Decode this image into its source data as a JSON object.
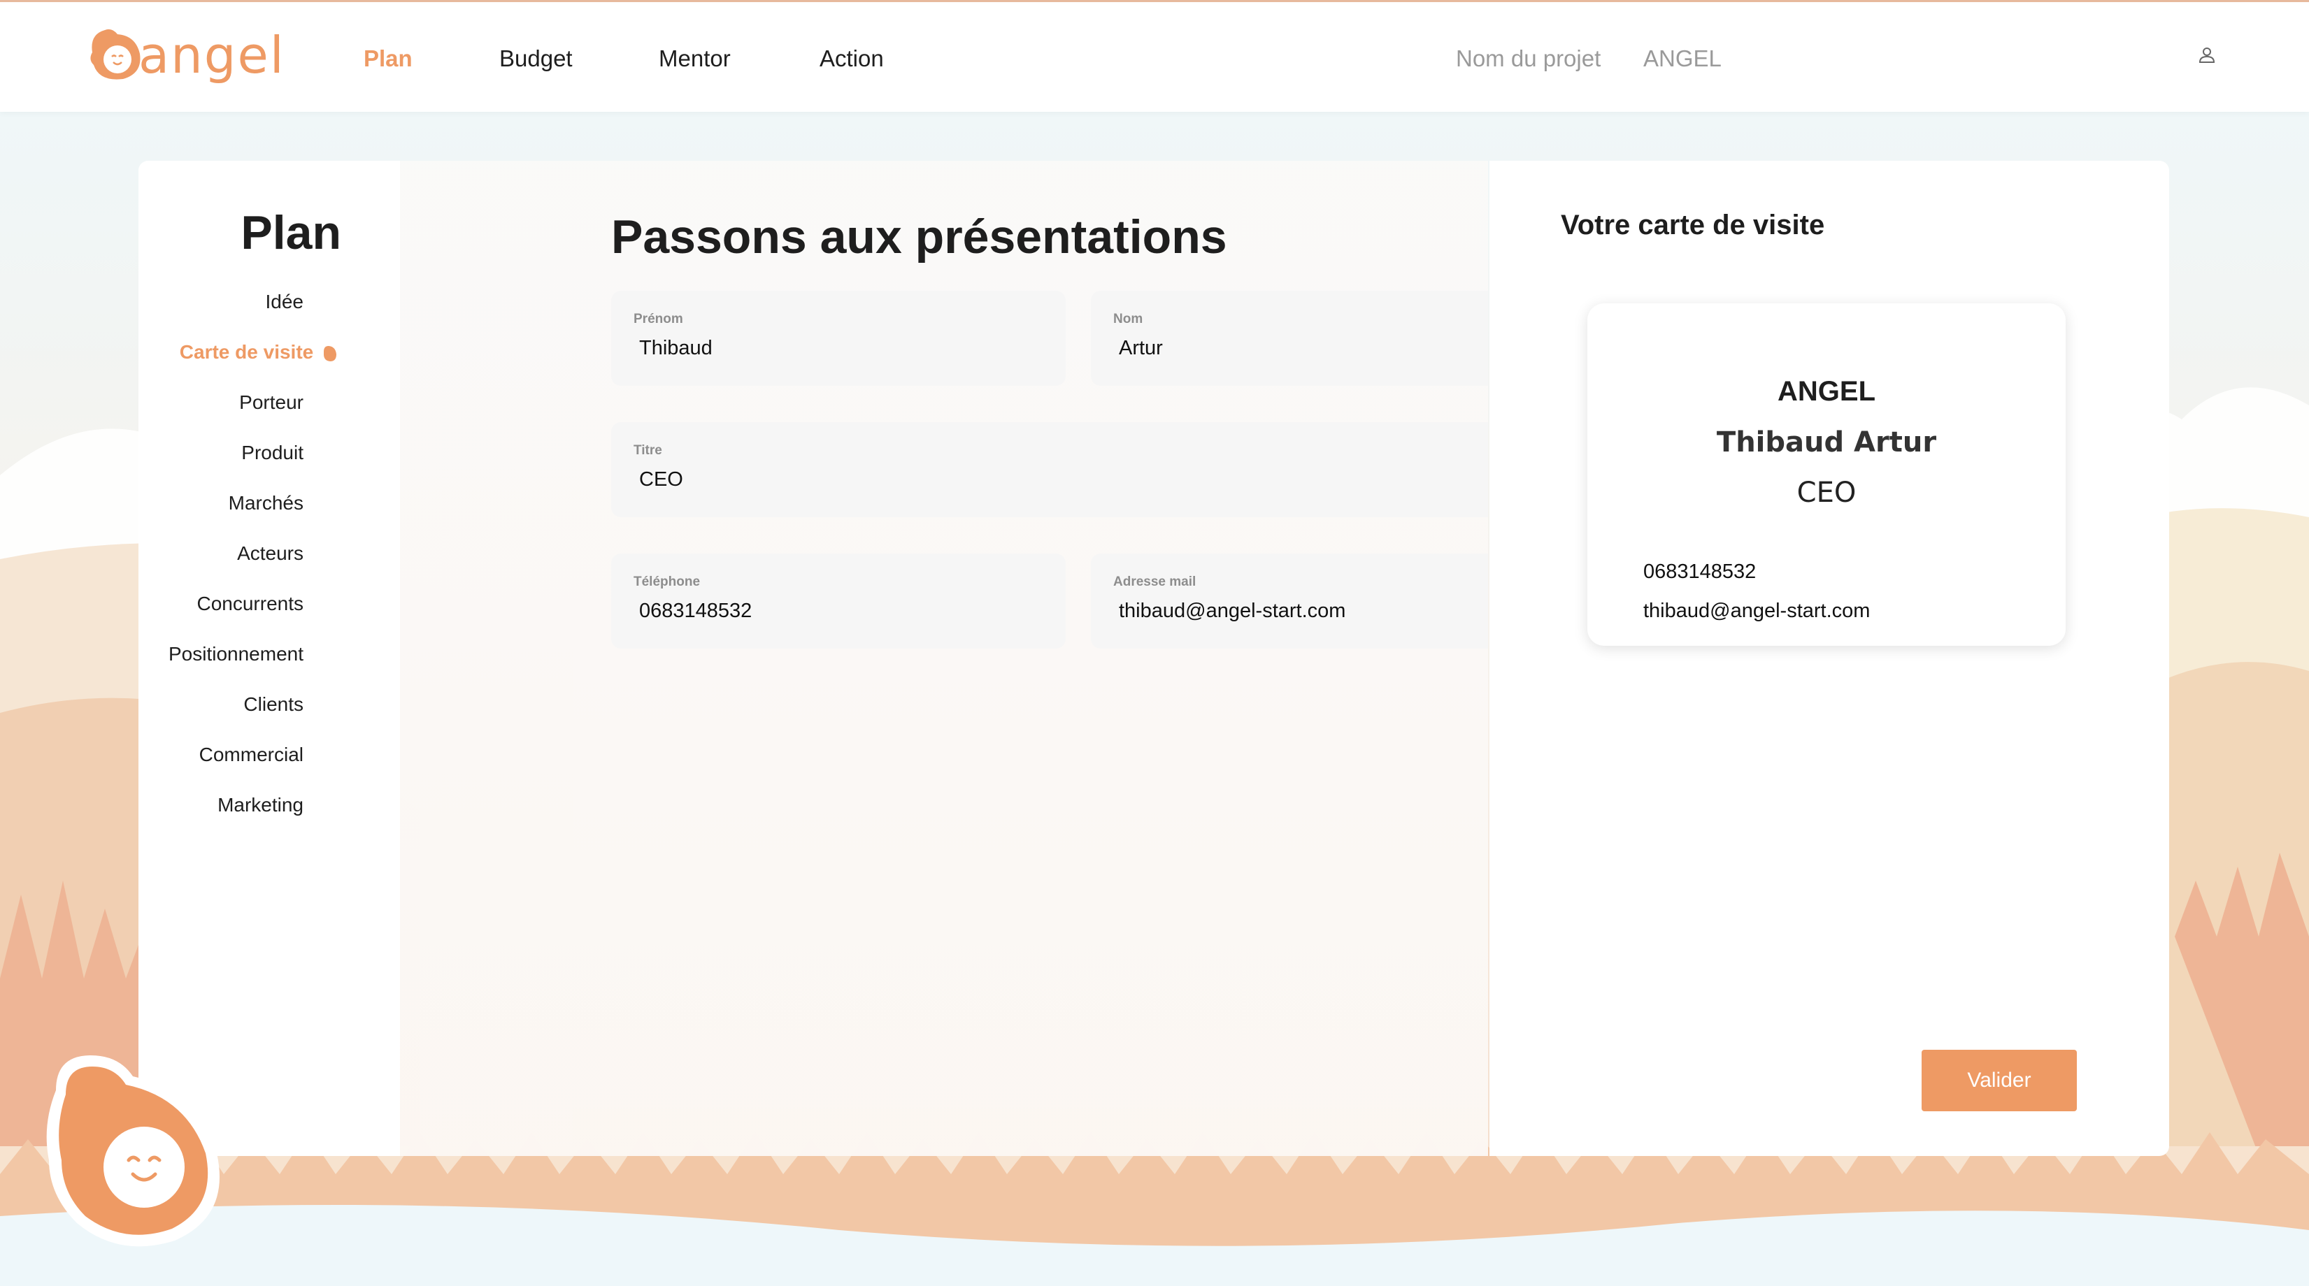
{
  "brand": {
    "name": "angel",
    "accent": "#ee9a64"
  },
  "nav": {
    "items": [
      "Plan",
      "Budget",
      "Mentor",
      "Action"
    ],
    "active": "Plan"
  },
  "project": {
    "label": "Nom du projet",
    "value": "ANGEL"
  },
  "icons": {
    "user": "user-icon",
    "mascot": "angel-mascot-icon",
    "drop": "drop-icon"
  },
  "sidebar": {
    "title": "Plan",
    "items": [
      "Idée",
      "Carte de visite",
      "Porteur",
      "Produit",
      "Marchés",
      "Acteurs",
      "Concurrents",
      "Positionnement",
      "Clients",
      "Commercial",
      "Marketing"
    ],
    "active_index": 1
  },
  "form": {
    "title": "Passons aux présentations",
    "fields": {
      "prenom": {
        "label": "Prénom",
        "value": "Thibaud"
      },
      "nom": {
        "label": "Nom",
        "value": "Artur"
      },
      "titre": {
        "label": "Titre",
        "value": "CEO"
      },
      "telephone": {
        "label": "Téléphone",
        "value": "0683148532"
      },
      "email": {
        "label": "Adresse mail",
        "value": "thibaud@angel-start.com"
      }
    }
  },
  "card_preview": {
    "title": "Votre carte de visite",
    "company": "ANGEL",
    "name": "Thibaud Artur",
    "role": "CEO",
    "phone": "0683148532",
    "email": "thibaud@angel-start.com"
  },
  "actions": {
    "validate": "Valider"
  }
}
